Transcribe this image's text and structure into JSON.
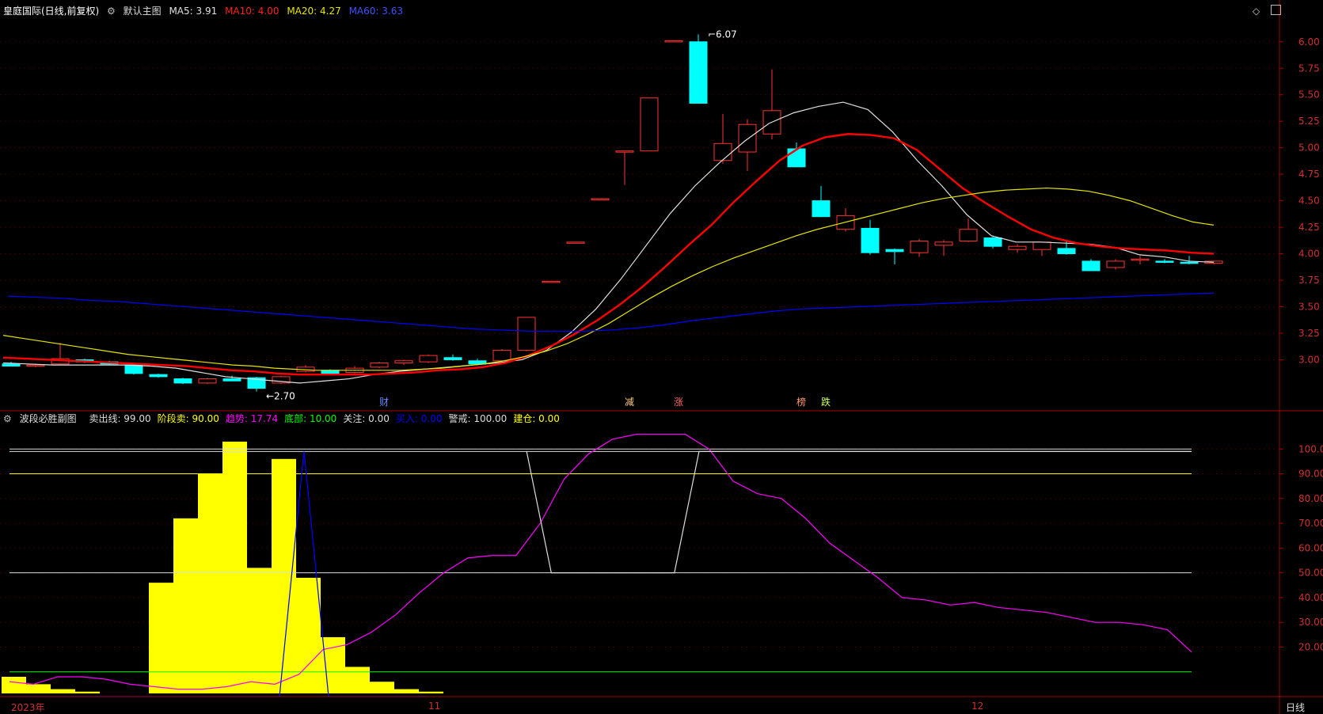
{
  "header": {
    "stock_title": "皇庭国际(日线,前复权)",
    "main_label": "默认主图",
    "ma5": "MA5: 3.91",
    "ma10": "MA10: 4.00",
    "ma20": "MA20: 4.27",
    "ma60": "MA60: 3.63",
    "gear_icon": "gear-icon",
    "top_right_icons": [
      "diamond-icon",
      "panel-icon"
    ]
  },
  "sub_header": {
    "name": "波段必胜副图",
    "items": [
      {
        "text": "卖出线: 99.00",
        "color": "#dddddd"
      },
      {
        "text": "阶段卖: 90.00",
        "color": "#ffff00"
      },
      {
        "text": "趋势: 17.74",
        "color": "#ff00ff"
      },
      {
        "text": "底部: 10.00",
        "color": "#00ff00"
      },
      {
        "text": "关注: 0.00",
        "color": "#dddddd"
      },
      {
        "text": "买入: 0.00",
        "color": "#0000ff"
      },
      {
        "text": "警戒: 100.00",
        "color": "#dddddd"
      },
      {
        "text": "建仓: 0.00",
        "color": "#ffff00"
      }
    ]
  },
  "bottom_bar": {
    "year_label": "2023年",
    "month_labels": [
      "11",
      "12"
    ],
    "period_label": "日线"
  },
  "colors": {
    "up": "#ff3232",
    "down": "#00ffff",
    "ma5": "#e0e0e0",
    "ma10": "#ff0000",
    "ma20": "#e5e500",
    "ma60": "#0000ff",
    "axis": "#a00000"
  },
  "chart_data": [
    {
      "type": "candlestick",
      "title": "皇庭国际(日线,前复权)",
      "ylim": [
        2.6,
        6.2
      ],
      "y_ticks": [
        "6.00",
        "5.75",
        "5.50",
        "5.25",
        "5.00",
        "4.75",
        "4.50",
        "4.25",
        "4.00",
        "3.75",
        "3.50",
        "3.25",
        "3.00"
      ],
      "max_label": "6.07",
      "min_label": "2.70",
      "candles": [
        {
          "o": 2.96,
          "h": 2.98,
          "l": 2.94,
          "c": 2.94
        },
        {
          "o": 2.94,
          "h": 2.96,
          "l": 2.93,
          "c": 2.95
        },
        {
          "o": 2.96,
          "h": 3.16,
          "l": 2.95,
          "c": 3.01
        },
        {
          "o": 3.0,
          "h": 3.01,
          "l": 2.97,
          "c": 2.98
        },
        {
          "o": 2.98,
          "h": 2.99,
          "l": 2.95,
          "c": 2.96
        },
        {
          "o": 2.95,
          "h": 2.96,
          "l": 2.86,
          "c": 2.87
        },
        {
          "o": 2.86,
          "h": 2.87,
          "l": 2.83,
          "c": 2.84
        },
        {
          "o": 2.82,
          "h": 2.83,
          "l": 2.77,
          "c": 2.78
        },
        {
          "o": 2.78,
          "h": 2.83,
          "l": 2.77,
          "c": 2.82
        },
        {
          "o": 2.82,
          "h": 2.85,
          "l": 2.8,
          "c": 2.8
        },
        {
          "o": 2.83,
          "h": 2.84,
          "l": 2.7,
          "c": 2.73
        },
        {
          "o": 2.78,
          "h": 2.85,
          "l": 2.77,
          "c": 2.84
        },
        {
          "o": 2.89,
          "h": 2.95,
          "l": 2.88,
          "c": 2.93
        },
        {
          "o": 2.9,
          "h": 2.91,
          "l": 2.86,
          "c": 2.86
        },
        {
          "o": 2.88,
          "h": 2.94,
          "l": 2.86,
          "c": 2.92
        },
        {
          "o": 2.93,
          "h": 2.98,
          "l": 2.92,
          "c": 2.97
        },
        {
          "o": 2.97,
          "h": 3.0,
          "l": 2.95,
          "c": 2.99
        },
        {
          "o": 2.98,
          "h": 3.05,
          "l": 2.97,
          "c": 3.04
        },
        {
          "o": 3.02,
          "h": 3.05,
          "l": 2.99,
          "c": 3.0
        },
        {
          "o": 2.99,
          "h": 3.01,
          "l": 2.95,
          "c": 2.96
        },
        {
          "o": 2.99,
          "h": 3.1,
          "l": 2.98,
          "c": 3.09
        },
        {
          "o": 3.09,
          "h": 3.4,
          "l": 3.08,
          "c": 3.4
        },
        {
          "o": 3.74,
          "h": 3.74,
          "l": 3.74,
          "c": 3.74
        },
        {
          "o": 4.11,
          "h": 4.11,
          "l": 4.11,
          "c": 4.11
        },
        {
          "o": 4.52,
          "h": 4.52,
          "l": 4.52,
          "c": 4.52
        },
        {
          "o": 4.97,
          "h": 4.97,
          "l": 4.65,
          "c": 4.97
        },
        {
          "o": 4.97,
          "h": 5.47,
          "l": 4.97,
          "c": 5.47
        },
        {
          "o": 6.01,
          "h": 6.01,
          "l": 6.01,
          "c": 6.01
        },
        {
          "o": 6.0,
          "h": 6.07,
          "l": 5.42,
          "c": 5.42
        },
        {
          "o": 4.88,
          "h": 5.32,
          "l": 4.85,
          "c": 5.04
        },
        {
          "o": 4.96,
          "h": 5.27,
          "l": 4.78,
          "c": 5.22
        },
        {
          "o": 5.13,
          "h": 5.74,
          "l": 5.08,
          "c": 5.35
        },
        {
          "o": 4.99,
          "h": 5.05,
          "l": 4.82,
          "c": 4.82
        },
        {
          "o": 4.5,
          "h": 4.64,
          "l": 4.35,
          "c": 4.35
        },
        {
          "o": 4.23,
          "h": 4.43,
          "l": 4.21,
          "c": 4.36
        },
        {
          "o": 4.24,
          "h": 4.32,
          "l": 3.99,
          "c": 4.01
        },
        {
          "o": 4.04,
          "h": 4.05,
          "l": 3.9,
          "c": 4.02
        },
        {
          "o": 4.01,
          "h": 4.14,
          "l": 3.97,
          "c": 4.12
        },
        {
          "o": 4.08,
          "h": 4.13,
          "l": 3.98,
          "c": 4.11
        },
        {
          "o": 4.12,
          "h": 4.33,
          "l": 4.11,
          "c": 4.23
        },
        {
          "o": 4.15,
          "h": 4.17,
          "l": 4.05,
          "c": 4.07
        },
        {
          "o": 4.04,
          "h": 4.09,
          "l": 4.01,
          "c": 4.07
        },
        {
          "o": 4.04,
          "h": 4.11,
          "l": 3.98,
          "c": 4.11
        },
        {
          "o": 4.05,
          "h": 4.12,
          "l": 3.99,
          "c": 4.0
        },
        {
          "o": 3.93,
          "h": 3.95,
          "l": 3.84,
          "c": 3.84
        },
        {
          "o": 3.87,
          "h": 3.95,
          "l": 3.85,
          "c": 3.93
        },
        {
          "o": 3.94,
          "h": 3.98,
          "l": 3.9,
          "c": 3.95
        },
        {
          "o": 3.93,
          "h": 3.95,
          "l": 3.91,
          "c": 3.92
        },
        {
          "o": 3.92,
          "h": 3.98,
          "l": 3.9,
          "c": 3.91
        },
        {
          "o": 3.91,
          "h": 3.93,
          "l": 3.9,
          "c": 3.93
        }
      ],
      "series": [
        {
          "name": "MA5",
          "values": [
            2.97,
            2.96,
            2.95,
            2.95,
            2.95,
            2.95,
            2.94,
            2.92,
            2.88,
            2.84,
            2.82,
            2.8,
            2.78,
            2.8,
            2.82,
            2.86,
            2.89,
            2.91,
            2.93,
            2.95,
            2.97,
            3.0,
            3.09,
            3.26,
            3.48,
            3.76,
            4.07,
            4.38,
            4.64,
            4.86,
            5.06,
            5.23,
            5.33,
            5.39,
            5.43,
            5.36,
            5.15,
            4.88,
            4.64,
            4.37,
            4.17,
            4.11,
            4.11,
            4.1,
            4.09,
            4.06,
            3.99,
            3.97,
            3.93,
            3.92
          ]
        },
        {
          "name": "MA10",
          "values": [
            3.02,
            3.01,
            3.0,
            2.99,
            2.98,
            2.97,
            2.96,
            2.95,
            2.94,
            2.92,
            2.9,
            2.89,
            2.87,
            2.86,
            2.86,
            2.86,
            2.86,
            2.87,
            2.88,
            2.9,
            2.91,
            2.93,
            2.97,
            3.04,
            3.13,
            3.24,
            3.37,
            3.52,
            3.69,
            3.88,
            4.08,
            4.27,
            4.49,
            4.69,
            4.88,
            5.02,
            5.1,
            5.13,
            5.12,
            5.09,
            4.98,
            4.8,
            4.62,
            4.48,
            4.35,
            4.23,
            4.15,
            4.1,
            4.07,
            4.05,
            4.04,
            4.03,
            4.01,
            4.0
          ]
        },
        {
          "name": "MA20",
          "values": [
            3.23,
            3.2,
            3.17,
            3.14,
            3.11,
            3.08,
            3.05,
            3.03,
            3.01,
            2.99,
            2.97,
            2.95,
            2.94,
            2.92,
            2.91,
            2.9,
            2.9,
            2.9,
            2.9,
            2.9,
            2.91,
            2.92,
            2.94,
            2.96,
            2.99,
            3.03,
            3.08,
            3.15,
            3.24,
            3.34,
            3.46,
            3.58,
            3.69,
            3.79,
            3.88,
            3.96,
            4.03,
            4.1,
            4.17,
            4.23,
            4.28,
            4.33,
            4.38,
            4.43,
            4.48,
            4.52,
            4.55,
            4.58,
            4.6,
            4.61,
            4.62,
            4.61,
            4.59,
            4.55,
            4.5,
            4.43,
            4.36,
            4.3,
            4.27
          ]
        },
        {
          "name": "MA60",
          "values": [
            3.6,
            3.59,
            3.58,
            3.56,
            3.55,
            3.53,
            3.51,
            3.49,
            3.47,
            3.45,
            3.43,
            3.41,
            3.39,
            3.37,
            3.35,
            3.33,
            3.31,
            3.29,
            3.28,
            3.27,
            3.27,
            3.27,
            3.28,
            3.3,
            3.33,
            3.37,
            3.4,
            3.43,
            3.46,
            3.48,
            3.49,
            3.5,
            3.51,
            3.52,
            3.53,
            3.54,
            3.55,
            3.56,
            3.57,
            3.58,
            3.59,
            3.6,
            3.61,
            3.62,
            3.63
          ]
        }
      ],
      "markers": [
        {
          "text": "财",
          "index": 15,
          "color": "#6688ff"
        },
        {
          "text": "减",
          "index": 25,
          "color": "#ffd080"
        },
        {
          "text": "涨",
          "index": 27,
          "color": "#ff6666"
        },
        {
          "text": "榜",
          "index": 32,
          "color": "#ff9966"
        },
        {
          "text": "跌",
          "index": 33,
          "color": "#ccff66"
        }
      ]
    },
    {
      "type": "area",
      "title": "波段必胜副图",
      "ylim": [
        0,
        110
      ],
      "y_ticks": [
        "100.0",
        "90.00",
        "80.00",
        "70.00",
        "60.00",
        "50.00",
        "40.00",
        "30.00",
        "20.00"
      ],
      "reference_lines": [
        {
          "name": "卖出线",
          "value": 99,
          "color": "#dddddd"
        },
        {
          "name": "警戒",
          "value": 100,
          "color": "#dddddd"
        },
        {
          "name": "阶段卖",
          "value": 90,
          "color": "#ffff00"
        },
        {
          "name": "关注",
          "value": 50,
          "color": "#dddddd"
        },
        {
          "name": "底部",
          "value": 10,
          "color": "#00ff00"
        },
        {
          "name": "建仓",
          "value": 0,
          "color": "#ffff00"
        }
      ],
      "bars": [
        8,
        5,
        3,
        2,
        1,
        0,
        46,
        72,
        90,
        103,
        52,
        96,
        48,
        24,
        12,
        6,
        3,
        2,
        1,
        1,
        0.5,
        0.5
      ],
      "series": [
        {
          "name": "趋势",
          "values": [
            6,
            5,
            8,
            8,
            7,
            5,
            4,
            3,
            3,
            4,
            6,
            5,
            9,
            19,
            21,
            26,
            33,
            42,
            50,
            56,
            57,
            57,
            70,
            88,
            98,
            104,
            106,
            106,
            106,
            100,
            87,
            82,
            80,
            72,
            62,
            55,
            48,
            40,
            39,
            37,
            38,
            36,
            35,
            34,
            32,
            30,
            30,
            29,
            27,
            18
          ]
        },
        {
          "name": "买入",
          "values": [
            0,
            0,
            0,
            0,
            0,
            0,
            0,
            0,
            0,
            0,
            0,
            0,
            99,
            0,
            0,
            0,
            0,
            0
          ]
        },
        {
          "name": "卖出线",
          "values": [
            null,
            null,
            null,
            null,
            null,
            null,
            null,
            null,
            null,
            null,
            null,
            null,
            null,
            null,
            null,
            null,
            null,
            null,
            null,
            null,
            null,
            99,
            50,
            50,
            50,
            50,
            50,
            50,
            99,
            99,
            99,
            99,
            99,
            99,
            99,
            99,
            99,
            99,
            99,
            99,
            99,
            99,
            99,
            99,
            99,
            99,
            99,
            99,
            99
          ]
        }
      ]
    }
  ]
}
